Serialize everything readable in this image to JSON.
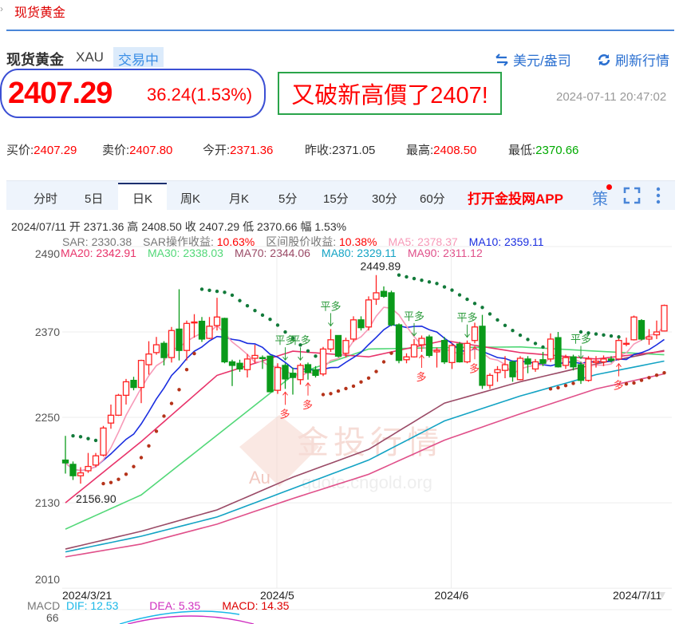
{
  "breadcrumb": {
    "current": "现货黄金",
    "mark": "›"
  },
  "header": {
    "title": "现货黄金",
    "code": "XAU",
    "status": "交易中",
    "unit_label": "美元/盎司",
    "refresh_label": "刷新行情",
    "unit_icon": "swap-arrows-icon",
    "refresh_icon": "refresh-icon"
  },
  "quote": {
    "price": "2407.29",
    "change": "36.24(1.53%)",
    "annotation": "又破新高價了2407!",
    "timestamp": "2024-07-11 20:47:02"
  },
  "stats": [
    {
      "label": "买价:",
      "value": "2407.29",
      "color": "red"
    },
    {
      "label": "卖价:",
      "value": "2407.80",
      "color": "red"
    },
    {
      "label": "今开:",
      "value": "2371.36",
      "color": "red"
    },
    {
      "label": "昨收:",
      "value": "2371.05",
      "color": "plain"
    },
    {
      "label": "最高:",
      "value": "2408.50",
      "color": "red"
    },
    {
      "label": "最低:",
      "value": "2370.66",
      "color": "green"
    }
  ],
  "tabs": [
    "分时",
    "5日",
    "日K",
    "周K",
    "月K",
    "5分",
    "15分",
    "30分",
    "60分"
  ],
  "active_tab": "日K",
  "app_link": "打开金投网APP",
  "strategy_label": "策",
  "colors": {
    "up": "#ff2222",
    "down": "#0a9a1a",
    "ma5": "#f79ab8",
    "ma10": "#1a2ee0",
    "ma20": "#e8336a",
    "ma30": "#52d878",
    "ma70": "#9a4a66",
    "ma80": "#13a3c4",
    "ma90": "#e0508a",
    "sar_up": "#b5331a",
    "sar_down": "#127a3a",
    "accent": "#2a6fd0"
  },
  "chart_data": {
    "type": "candlestick",
    "info_line": "2024/07/11  开 2371.36  高 2408.50  收 2407.29  低 2370.66  幅 1.53%",
    "indicators_row1": [
      {
        "label": "SAR: 2330.38",
        "color": "#777"
      },
      {
        "label": "SAR操作收益: ",
        "color": "#777"
      },
      {
        "label": "10.63%",
        "color": "#f00"
      },
      {
        "label": "区间股价收益: ",
        "color": "#777"
      },
      {
        "label": "10.38%",
        "color": "#f00"
      },
      {
        "label": "MA5: 2378.37",
        "color": "#f79ab8"
      },
      {
        "label": "MA10: 2359.11",
        "color": "#1a2ee0"
      }
    ],
    "indicators_row2": [
      {
        "label": "MA20: 2342.91",
        "color": "#e8336a"
      },
      {
        "label": "MA30: 2338.03",
        "color": "#52d878"
      },
      {
        "label": "MA70: 2344.06",
        "color": "#9a4a66"
      },
      {
        "label": "MA80: 2329.11",
        "color": "#13a3c4"
      },
      {
        "label": "MA90: 2311.12",
        "color": "#e0508a"
      }
    ],
    "ylim": [
      2010,
      2490
    ],
    "yticks": [
      2490,
      2370,
      2250,
      2130,
      2010
    ],
    "xticks": [
      {
        "label": "2024/3/21",
        "index": 0
      },
      {
        "label": "2024/5",
        "index": 28
      },
      {
        "label": "2024/6",
        "index": 51
      },
      {
        "label": "2024/7/11",
        "index": 79
      }
    ],
    "month_lines": [
      28,
      51
    ],
    "ohlc": [
      [
        2190,
        2224,
        2171,
        2186
      ],
      [
        2184,
        2188,
        2162,
        2168
      ],
      [
        2168,
        2180,
        2156.9,
        2172
      ],
      [
        2175,
        2200,
        2172,
        2181
      ],
      [
        2183,
        2200,
        2180,
        2196
      ],
      [
        2197,
        2238,
        2195,
        2235
      ],
      [
        2242,
        2268,
        2234,
        2253
      ],
      [
        2253,
        2283,
        2252,
        2281
      ],
      [
        2281,
        2304,
        2268,
        2300
      ],
      [
        2302,
        2307,
        2288,
        2292
      ],
      [
        2292,
        2331,
        2270,
        2330
      ],
      [
        2324,
        2357,
        2310,
        2339
      ],
      [
        2341,
        2363,
        2338,
        2352
      ],
      [
        2354,
        2357,
        2323,
        2334
      ],
      [
        2334,
        2377,
        2327,
        2372
      ],
      [
        2374,
        2430,
        2330,
        2344
      ],
      [
        2344,
        2386,
        2330,
        2382
      ],
      [
        2383,
        2395,
        2362,
        2384
      ],
      [
        2385,
        2391,
        2356,
        2360
      ],
      [
        2361,
        2391,
        2360,
        2378
      ],
      [
        2379,
        2418,
        2372,
        2391
      ],
      [
        2389,
        2390,
        2326,
        2328
      ],
      [
        2328,
        2331,
        2294,
        2323
      ],
      [
        2326,
        2331,
        2314,
        2318
      ],
      [
        2317,
        2339,
        2306,
        2332
      ],
      [
        2333,
        2352,
        2326,
        2337
      ],
      [
        2334,
        2337,
        2318,
        2333
      ],
      [
        2336,
        2337,
        2286,
        2286
      ],
      [
        2288,
        2326,
        2283,
        2320
      ],
      [
        2323,
        2326,
        2290,
        2304
      ],
      [
        2312,
        2320,
        2282,
        2306
      ],
      [
        2303,
        2326,
        2296,
        2323
      ],
      [
        2324,
        2327,
        2303,
        2313
      ],
      [
        2317,
        2322,
        2306,
        2309
      ],
      [
        2311,
        2349,
        2308,
        2346
      ],
      [
        2346,
        2374,
        2342,
        2359
      ],
      [
        2365,
        2365,
        2334,
        2336
      ],
      [
        2340,
        2362,
        2334,
        2358
      ],
      [
        2360,
        2392,
        2356,
        2387
      ],
      [
        2387,
        2392,
        2372,
        2376
      ],
      [
        2377,
        2420,
        2372,
        2415
      ],
      [
        2416,
        2449.89,
        2408,
        2425
      ],
      [
        2427,
        2434,
        2418,
        2420
      ],
      [
        2425,
        2428,
        2378,
        2380
      ],
      [
        2380,
        2382,
        2326,
        2330
      ],
      [
        2331,
        2340,
        2326,
        2335
      ],
      [
        2335,
        2360,
        2334,
        2352
      ],
      [
        2352,
        2365,
        2342,
        2361
      ],
      [
        2363,
        2366,
        2334,
        2337
      ],
      [
        2342,
        2348,
        2320,
        2344
      ],
      [
        2358,
        2363,
        2325,
        2328
      ],
      [
        2327,
        2354,
        2318,
        2351
      ],
      [
        2353,
        2356,
        2327,
        2328
      ],
      [
        2328,
        2358,
        2326,
        2354
      ],
      [
        2358,
        2383,
        2354,
        2377
      ],
      [
        2378,
        2394,
        2290,
        2295
      ],
      [
        2295,
        2312,
        2290,
        2309
      ],
      [
        2313,
        2322,
        2300,
        2317
      ],
      [
        2316,
        2336,
        2305,
        2324
      ],
      [
        2328,
        2330,
        2300,
        2307
      ],
      [
        2303,
        2336,
        2302,
        2333
      ],
      [
        2332,
        2336,
        2312,
        2325
      ],
      [
        2318,
        2332,
        2314,
        2328
      ],
      [
        2331,
        2342,
        2322,
        2326
      ],
      [
        2332,
        2368,
        2328,
        2360
      ],
      [
        2362,
        2370,
        2320,
        2321
      ],
      [
        2323,
        2338,
        2318,
        2334
      ],
      [
        2335,
        2338,
        2316,
        2321
      ],
      [
        2324,
        2328,
        2297,
        2302
      ],
      [
        2302,
        2336,
        2300,
        2332
      ],
      [
        2327,
        2336,
        2320,
        2329
      ],
      [
        2328,
        2337,
        2322,
        2332
      ],
      [
        2332,
        2336,
        2327,
        2330
      ],
      [
        2332,
        2362,
        2330,
        2358
      ],
      [
        2353,
        2362,
        2350,
        2354
      ],
      [
        2359,
        2393,
        2358,
        2391
      ],
      [
        2386,
        2388,
        2358,
        2360
      ],
      [
        2360,
        2374,
        2352,
        2363
      ],
      [
        2366,
        2386,
        2360,
        2370
      ],
      [
        2371.36,
        2408.5,
        2370.66,
        2407.29
      ]
    ],
    "ma_samples_index": [
      0,
      10,
      20,
      30,
      40,
      50,
      60,
      70,
      79
    ],
    "ma20": [
      2130,
      2216,
      2309,
      2343,
      2335,
      2358,
      2341,
      2332,
      2342.91
    ],
    "ma30": [
      2093,
      2141,
      2225,
      2309,
      2346,
      2348,
      2349,
      2343,
      2338.03
    ],
    "ma70": [
      2065,
      2090,
      2120,
      2166,
      2205,
      2270,
      2300,
      2325,
      2344.06
    ],
    "ma80": [
      2061,
      2083,
      2110,
      2150,
      2190,
      2245,
      2280,
      2310,
      2329.11
    ],
    "ma90": [
      2054,
      2072,
      2100,
      2136,
      2170,
      2218,
      2255,
      2290,
      2311.12
    ],
    "max_label": {
      "text": "2449.89",
      "index": 41,
      "value": 2449.89
    },
    "min_label": {
      "text": "2156.90",
      "index": 2,
      "value": 2156.9
    },
    "signals": {
      "close_long_label": "平多",
      "long_label": "多",
      "close_long_at": [
        29,
        31,
        35,
        46,
        53,
        68
      ],
      "long_at": [
        29,
        32,
        47,
        54,
        73
      ]
    },
    "watermark": {
      "logo": "Au",
      "name": "金投行情",
      "site": "quote.cngold.org"
    },
    "macd": {
      "label": "MACD",
      "dif": "DIF: 12.53",
      "dea": "DEA: 5.35",
      "macd": "MACD: 14.35",
      "top_tick": "66"
    }
  }
}
